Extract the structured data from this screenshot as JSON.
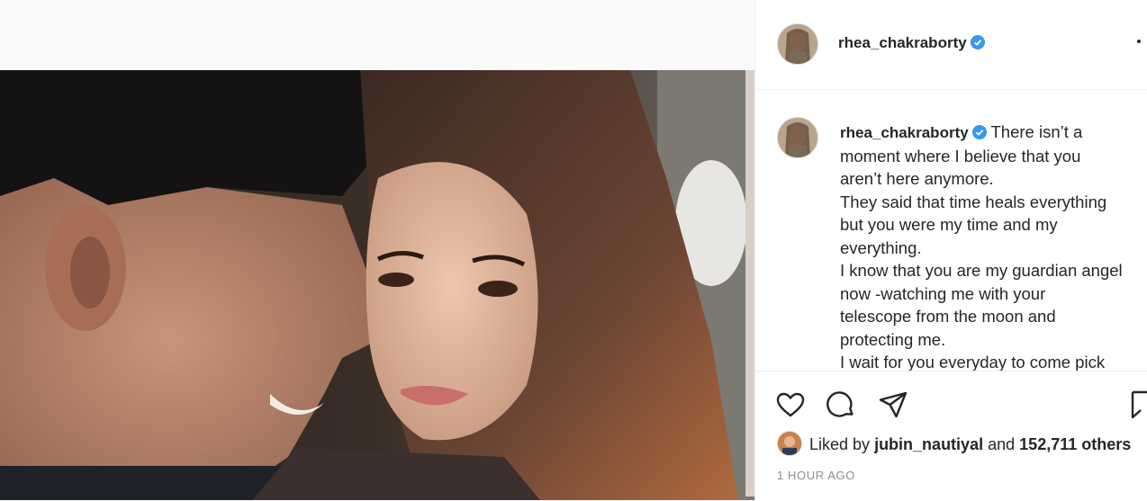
{
  "post": {
    "username": "rhea_chakraborty",
    "caption_lines": [
      "There isn’t a",
      "moment where I believe that you",
      "aren’t here anymore.",
      "They said that time heals everything",
      "but you were my time and my",
      "everything.",
      "I know that you are my guardian angel",
      "now -watching me with your",
      "telescope from the moon and",
      "protecting me.",
      "I wait for you everyday to come pick"
    ],
    "liked_by_prefix": "Liked by",
    "liked_by_user": "jubin_nautiyal",
    "liked_by_and": "and",
    "likes_count": "152,711 others",
    "timestamp": "1 HOUR AGO"
  },
  "icons": {
    "verified": "verified-badge-icon",
    "more": "more-options-icon",
    "like": "heart-icon",
    "comment": "comment-icon",
    "share": "paper-plane-icon",
    "save": "bookmark-icon"
  },
  "colors": {
    "verified_blue": "#3897f0",
    "text": "#262626",
    "muted": "#8e8e8e",
    "border": "#efefef"
  }
}
